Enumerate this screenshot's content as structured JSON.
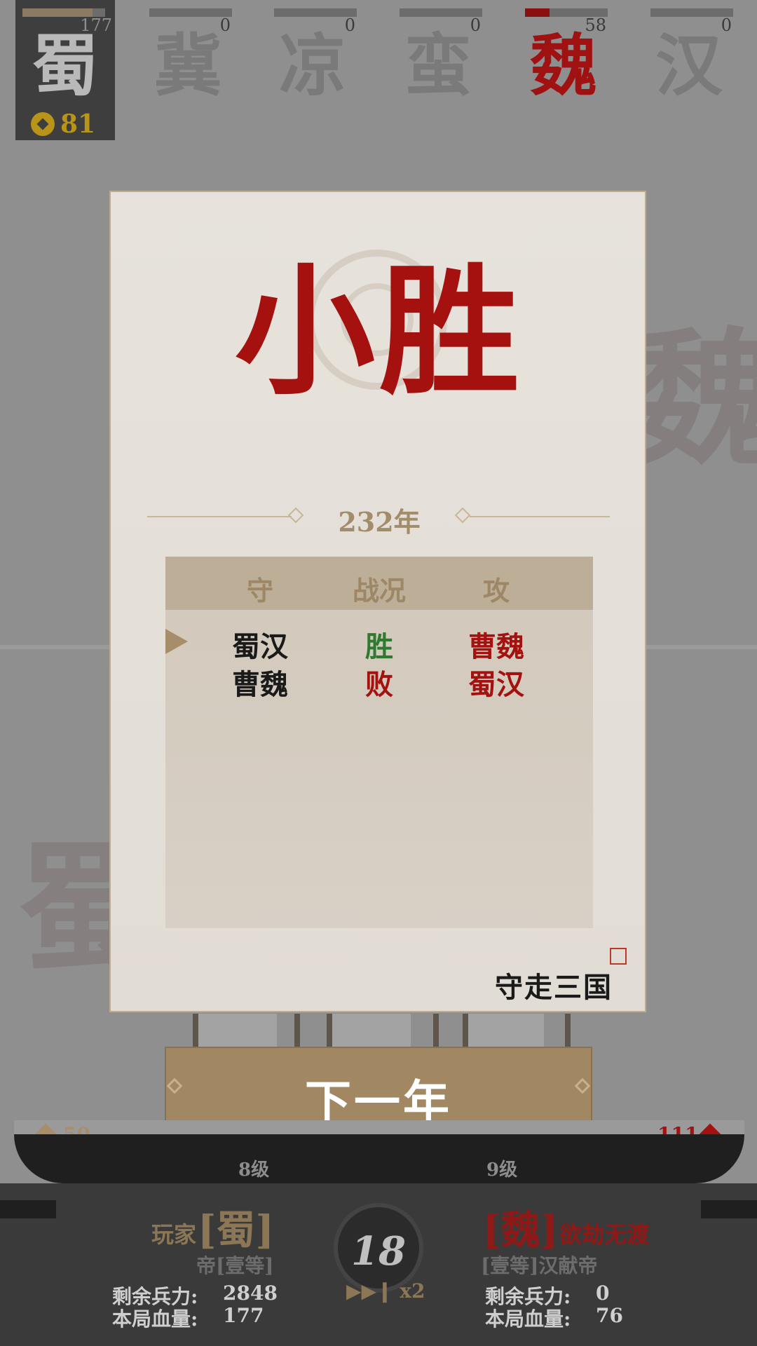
{
  "factions": [
    {
      "char": "蜀",
      "count": "177",
      "fill_fraction": 0.85,
      "bar_color": "#8b7a64"
    },
    {
      "char": "冀",
      "count": "0",
      "fill_fraction": 0,
      "bar_color": "#6c6c6c"
    },
    {
      "char": "凉",
      "count": "0",
      "fill_fraction": 0,
      "bar_color": "#6c6c6c"
    },
    {
      "char": "蛮",
      "count": "0",
      "fill_fraction": 0,
      "bar_color": "#6c6c6c"
    },
    {
      "char": "魏",
      "count": "58",
      "fill_fraction": 0.3,
      "bar_color": "#8a0f0f"
    },
    {
      "char": "汉",
      "count": "0",
      "fill_fraction": 0,
      "bar_color": "#6c6c6c"
    }
  ],
  "player_coins": "81",
  "background": {
    "left_char": "蜀",
    "right_char": "魏"
  },
  "result": {
    "title": "小胜",
    "year": "232年",
    "headers": {
      "defend": "守",
      "status": "战况",
      "attack": "攻"
    },
    "rows": [
      {
        "defend": "蜀汉",
        "status": "胜",
        "attack": "曹魏",
        "status_color": "#2e7a2e"
      },
      {
        "defend": "曹魏",
        "status": "败",
        "attack": "蜀汉",
        "status_color": "#a4110f"
      }
    ],
    "brand": "守走三国"
  },
  "next_button": "下一年",
  "bottom_stats": {
    "left_gem_value": "50",
    "right_gem_value": "111",
    "left_level": "8级",
    "right_level": "9级"
  },
  "player": {
    "prefix": "玩家",
    "kingdom": "[蜀]",
    "rank": "帝[壹等]",
    "troops_label": "剩余兵力:",
    "troops_value": "2848",
    "hp_label": "本局血量:",
    "hp_value": "177"
  },
  "enemy": {
    "kingdom": "[魏]",
    "slogan": "欲劫无渡",
    "rank": "[壹等]汉献帝",
    "troops_label": "剩余兵力:",
    "troops_value": "0",
    "hp_label": "本局血量:",
    "hp_value": "76"
  },
  "timer": "18",
  "speed": "▶▶❙ x2",
  "colors": {
    "accent_red": "#a4110f",
    "gold": "#b89418",
    "bronze": "#a18862"
  }
}
